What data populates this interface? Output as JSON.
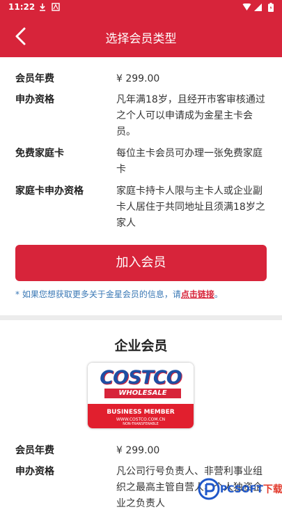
{
  "status_bar": {
    "time": "11:22"
  },
  "app_bar": {
    "title": "选择会员类型"
  },
  "gold_member": {
    "rows": [
      {
        "label": "会员年费",
        "value": "¥ 299.00"
      },
      {
        "label": "申办资格",
        "value": "凡年满18岁，且经开市客审核通过之个人可以申请成为金星主卡会员。"
      },
      {
        "label": "免费家庭卡",
        "value": "每位主卡会员可办理一张免费家庭卡"
      },
      {
        "label": "家庭卡申办资格",
        "value": "家庭卡持卡人限与主卡人或企业副卡人居住于共同地址且须满18岁之家人"
      }
    ],
    "join_button": "加入会员",
    "note_prefix": "* 如果您想获取更多关于金星会员的信息，请",
    "note_link": "点击链接",
    "note_suffix": "。"
  },
  "business_member": {
    "title": "企业会员",
    "card": {
      "brand": "COSTCO",
      "sub_brand": "WHOLESALE",
      "member_type": "BUSINESS MEMBER",
      "url": "WWW.COSTCO.COM.CN",
      "small_text": "NON-TRANSFERABLE"
    },
    "rows": [
      {
        "label": "会员年费",
        "value": "¥ 299.00"
      },
      {
        "label": "申办资格",
        "value": "凡公司行号负责人、非营利事业组织之最高主管自营人、个人独资企业之负责人"
      }
    ]
  },
  "watermark": {
    "text_a": "PCSOFT",
    "text_b": "下载"
  },
  "colors": {
    "primary": "#d7243a",
    "link_blue": "#3a78b5",
    "divider": "#ececec"
  }
}
